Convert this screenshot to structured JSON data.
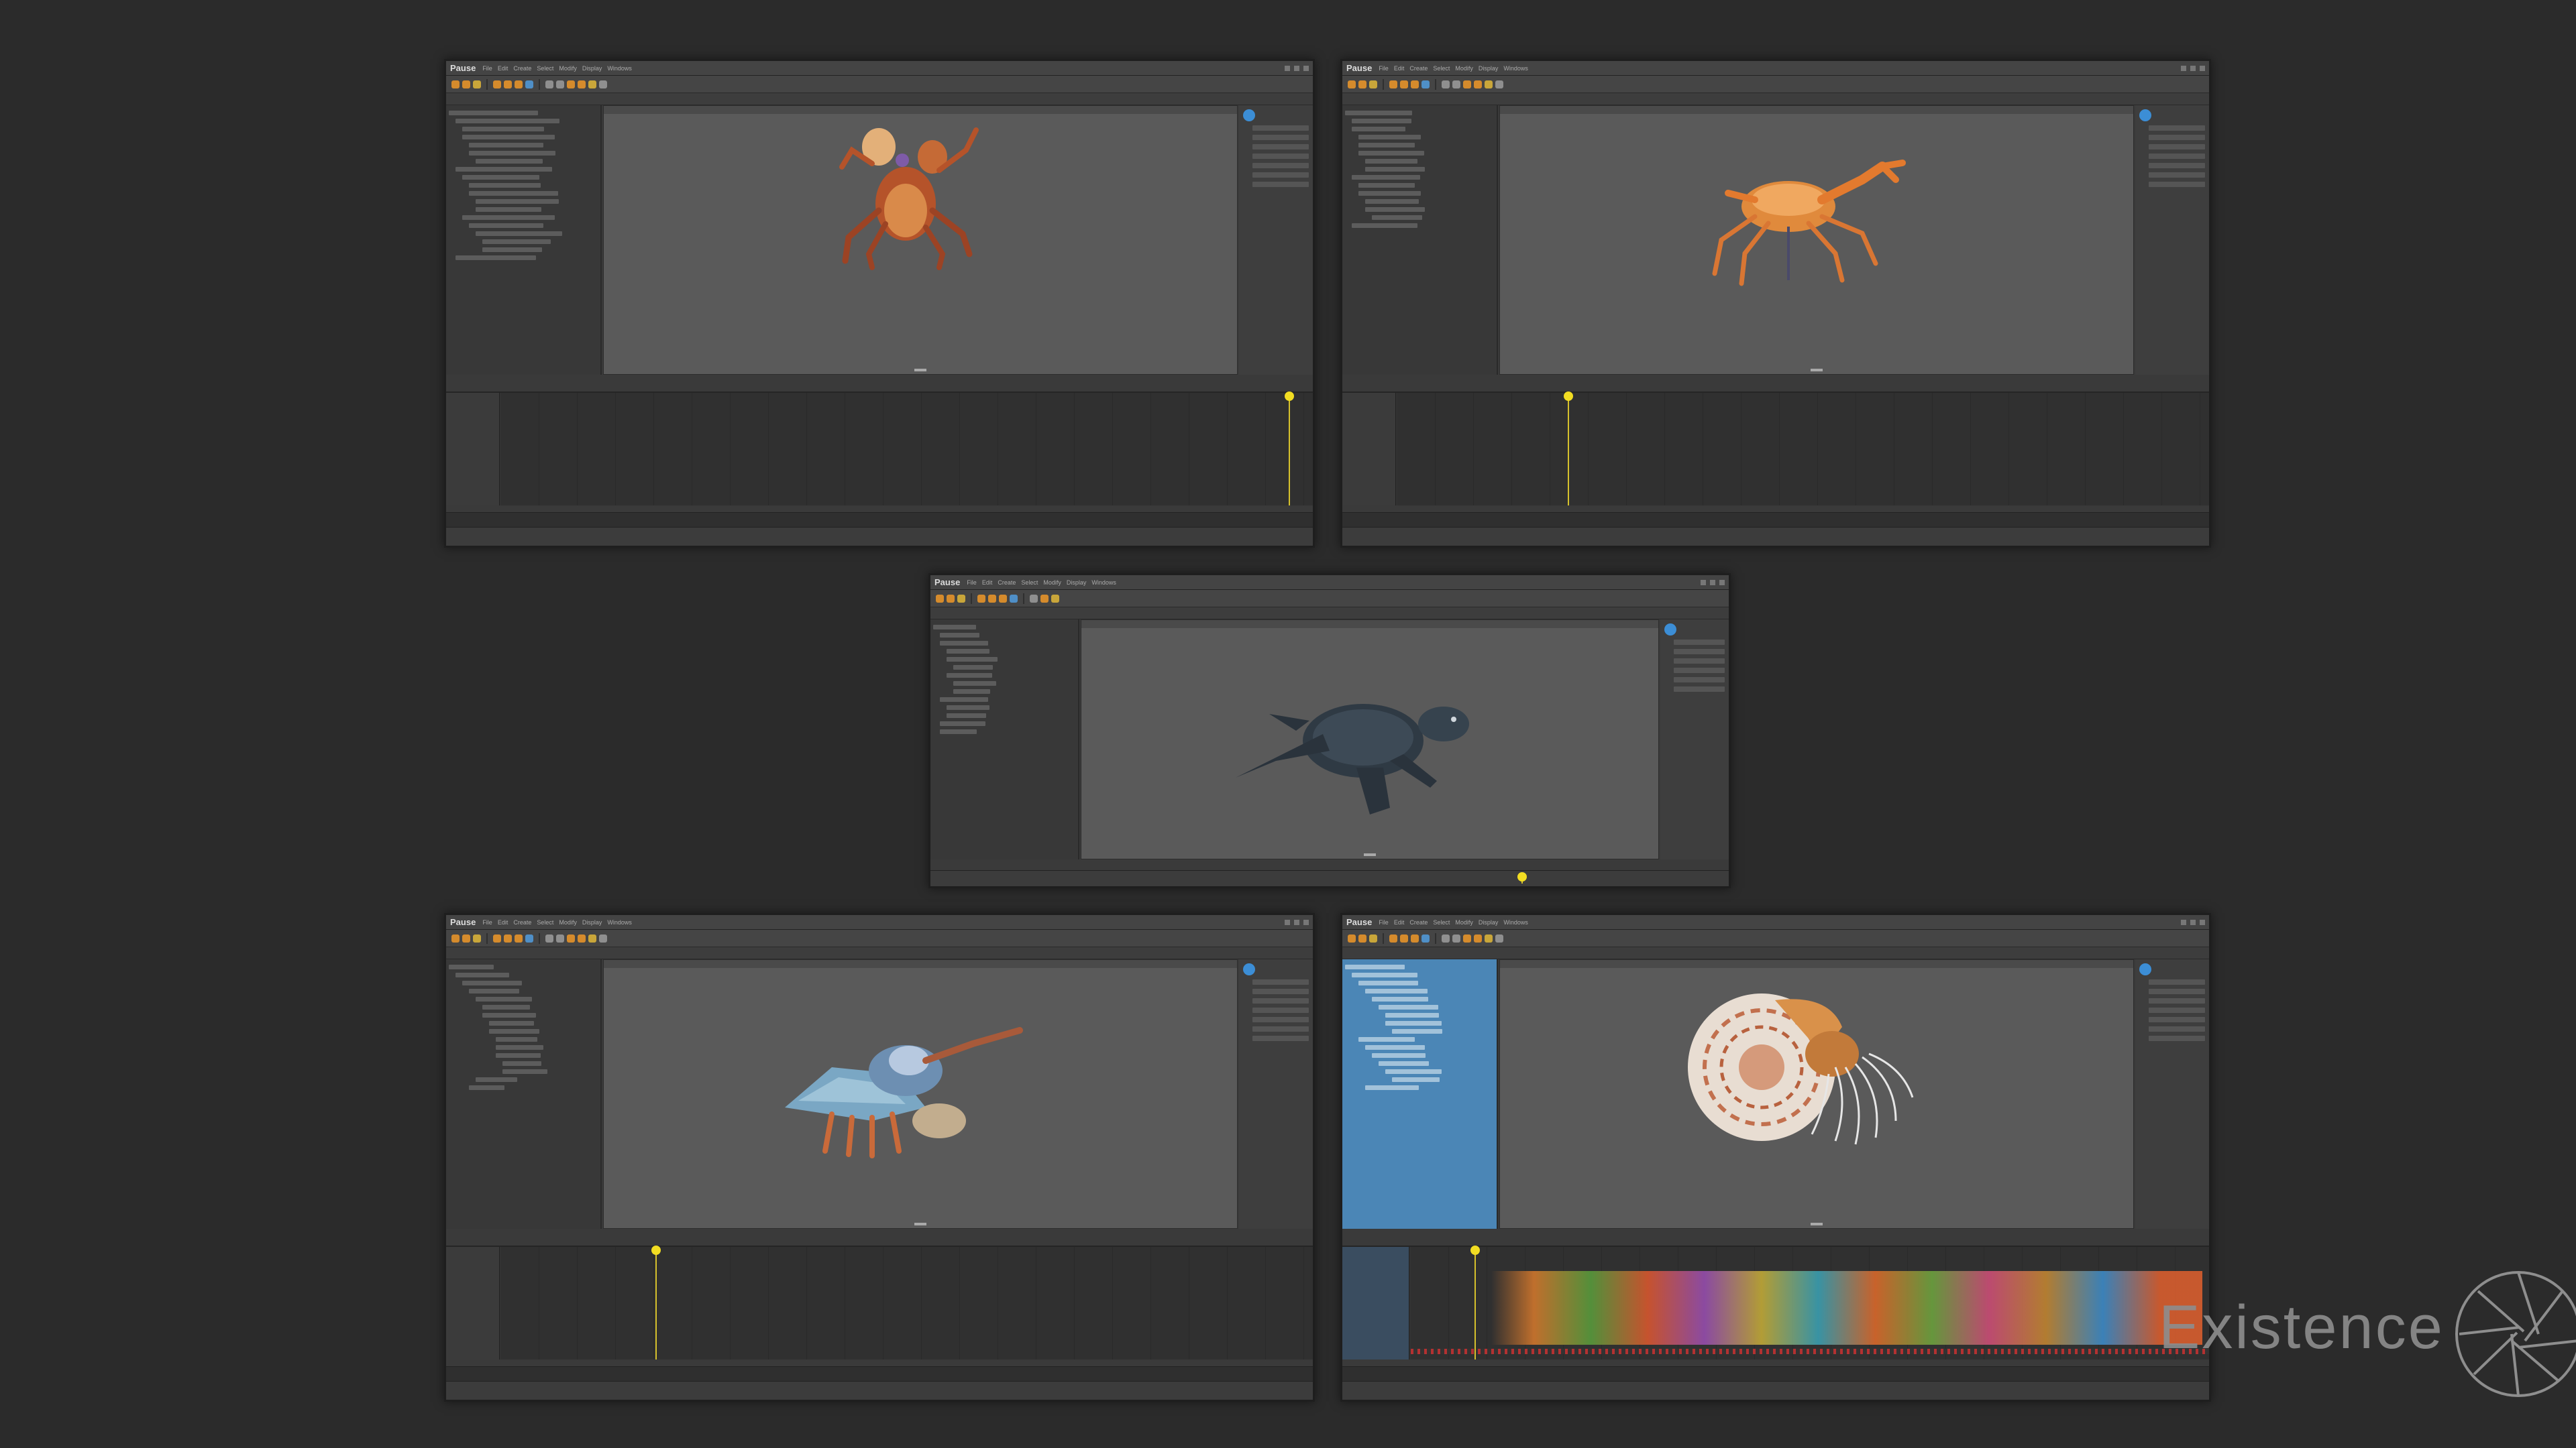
{
  "app": {
    "title": "Pause",
    "menu_items": [
      "File",
      "Edit",
      "Create",
      "Select",
      "Modify",
      "Display",
      "Windows"
    ]
  },
  "windows": [
    {
      "subject": "crab-upright",
      "playhead_fraction": 0.97
    },
    {
      "subject": "crab-walking",
      "playhead_fraction": 0.21
    },
    {
      "subject": "sea-turtle",
      "playhead_fraction": 0.74
    },
    {
      "subject": "mantis-shrimp",
      "playhead_fraction": 0.19
    },
    {
      "subject": "nautilus",
      "playhead_fraction": 0.08
    }
  ],
  "watermark": {
    "text": "Existence"
  },
  "colors": {
    "background": "#2b2b2b",
    "accent_orange": "#d58b2c",
    "maya_blue": "#3c8ed6",
    "playhead_yellow": "#f2dd22",
    "outliner_selected": "#4b86b6"
  }
}
